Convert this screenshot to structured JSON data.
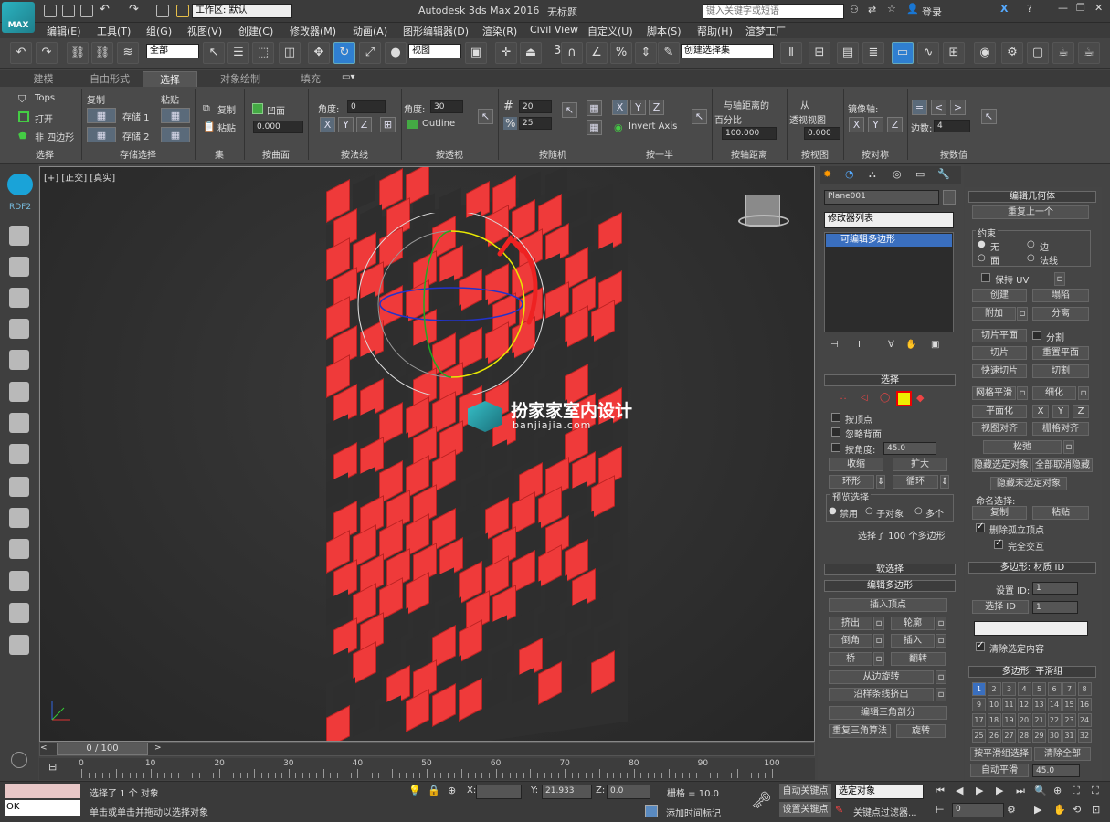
{
  "titlebar": {
    "workspace": "工作区: 默认",
    "app_title": "Autodesk 3ds Max 2016",
    "doc_title": "无标题",
    "search_placeholder": "键入关键字或短语",
    "login": "登录",
    "logo_text": "MAX"
  },
  "menubar": {
    "items": [
      "编辑(E)",
      "工具(T)",
      "组(G)",
      "视图(V)",
      "创建(C)",
      "修改器(M)",
      "动画(A)",
      "图形编辑器(D)",
      "渲染(R)",
      "Civil View",
      "自定义(U)",
      "脚本(S)",
      "帮助(H)",
      "渲梦工厂"
    ]
  },
  "toolbar": {
    "filter_select": "全部",
    "coord_select": "视图",
    "selection_set": "创建选择集",
    "snap_number": "3"
  },
  "ribbon": {
    "tabs": [
      "建模",
      "自由形式",
      "选择",
      "对象绘制",
      "填充"
    ],
    "active_tab": "选择",
    "groups": {
      "select": {
        "tops": "Tops",
        "open": "打开",
        "non_quad": "非 四边形",
        "footer": "选择"
      },
      "stored": {
        "copy": "复制",
        "paste": "粘贴",
        "store1": "存储 1",
        "store2": "存储 2",
        "footer": "存储选择"
      },
      "set": {
        "copy": "复制",
        "paste": "粘贴",
        "footer": "集"
      },
      "by_surface": {
        "concave": "凹面",
        "value": "0.000",
        "footer": "按曲面"
      },
      "by_normal": {
        "angle_label": "角度:",
        "angle": "0",
        "x": "X",
        "y": "Y",
        "z": "Z",
        "footer": "按法线"
      },
      "by_perspective": {
        "angle_label": "角度:",
        "angle": "30",
        "outline": "Outline",
        "footer": "按透视"
      },
      "by_random": {
        "count": "20",
        "percent": "25",
        "footer": "按随机"
      },
      "by_half": {
        "x": "X",
        "y": "Y",
        "z": "Z",
        "invert_axis": "Invert Axis",
        "footer": "按一半"
      },
      "by_axis_distance": {
        "label1": "与轴距离的",
        "label2": "百分比",
        "value": "100.000",
        "footer": "按轴距离"
      },
      "by_view": {
        "label1": "从",
        "label2": "透视视图",
        "value": "0.000",
        "footer": "按视图"
      },
      "by_symmetry": {
        "label": "镜像轴:",
        "x": "X",
        "y": "Y",
        "z": "Z",
        "footer": "按对称"
      },
      "by_numeric": {
        "sides_label": "边数:",
        "sides": "4",
        "footer": "按数值"
      }
    }
  },
  "leftbar": {
    "label": "RDF2"
  },
  "viewport": {
    "label": "[+] [正交] [真实]",
    "watermark": "扮家家室内设计",
    "watermark_url": "banjiajia.com",
    "tile_color": "#ef3a3a"
  },
  "command_panel": {
    "object_name": "Plane001",
    "modifier_list": "修改器列表",
    "stack_item": "可编辑多边形",
    "selection_rollout": "选择",
    "by_vertex": "按顶点",
    "ignore_backface": "忽略背面",
    "by_angle": "按角度:",
    "angle_value": "45.0",
    "shrink": "收缩",
    "grow": "扩大",
    "ring": "环形",
    "loop": "循环",
    "preview_selection": "预览选择",
    "disabled": "禁用",
    "sub_object": "子对象",
    "multi": "多个",
    "selected_count": "选择了 100 个多边形",
    "soft_selection": "软选择",
    "edit_polygons": "编辑多边形",
    "insert_vertex": "插入顶点",
    "extrude": "挤出",
    "outline": "轮廓",
    "bevel": "倒角",
    "inset": "插入",
    "bridge": "桥",
    "flip": "翻转",
    "hinge": "从边旋转",
    "extrude_spline": "沿样条线挤出",
    "edit_triangulation": "编辑三角剖分",
    "retriangulate": "重复三角算法",
    "turn": "旋转"
  },
  "edit_geometry": {
    "title": "编辑几何体",
    "repeat_last": "重复上一个",
    "constraints": "约束",
    "none": "无",
    "edge": "边",
    "face": "面",
    "normal": "法线",
    "preserve_uv": "保持 UV",
    "create": "创建",
    "collapse": "塌陷",
    "attach": "附加",
    "detach": "分离",
    "slice_plane": "切片平面",
    "split": "分割",
    "slice": "切片",
    "reset_plane": "重置平面",
    "quickslice": "快速切片",
    "cut": "切割",
    "meshsmooth": "网格平滑",
    "tessellate": "细化",
    "make_planar": "平面化",
    "x": "X",
    "y": "Y",
    "z": "Z",
    "view_align": "视图对齐",
    "grid_align": "栅格对齐",
    "relax": "松弛",
    "hide_selected": "隐藏选定对象",
    "unhide_all": "全部取消隐藏",
    "hide_unselected": "隐藏未选定对象",
    "named_selections": "命名选择:",
    "copy": "复制",
    "paste": "粘贴",
    "delete_isolated": "删除孤立顶点",
    "full_interactivity": "完全交互",
    "material_ids": "多边形: 材质 ID",
    "set_id": "设置 ID:",
    "set_id_value": "1",
    "select_id": "选择 ID",
    "select_id_value": "1",
    "clear_selection": "清除选定内容",
    "smoothing_groups": "多边形: 平滑组",
    "sg_numbers": [
      "1",
      "2",
      "3",
      "4",
      "5",
      "6",
      "7",
      "8",
      "9",
      "10",
      "11",
      "12",
      "13",
      "14",
      "15",
      "16",
      "17",
      "18",
      "19",
      "20",
      "21",
      "22",
      "23",
      "24",
      "25",
      "26",
      "27",
      "28",
      "29",
      "30",
      "31",
      "32"
    ],
    "select_by_sg": "按平滑组选择",
    "clear_all": "清除全部",
    "auto_smooth": "自动平滑",
    "auto_smooth_value": "45.0"
  },
  "timeline": {
    "frame_label": "0 / 100",
    "ticks": [
      "0",
      "10",
      "20",
      "30",
      "40",
      "50",
      "60",
      "70",
      "80",
      "90",
      "100"
    ]
  },
  "statusbar": {
    "maxscript": "OK",
    "selected": "选择了 1 个 对象",
    "prompt": "单击或单击并拖动以选择对象",
    "x_label": "X:",
    "x_value": "",
    "y_label": "Y:",
    "y_value": "21.933",
    "z_label": "Z:",
    "z_value": "0.0",
    "grid": "栅格 = 10.0",
    "add_time_tag": "添加时间标记",
    "auto_key": "自动关键点",
    "set_key": "设置关键点",
    "key_mode": "选定对象",
    "key_filters": "关键点过滤器...",
    "frame": "0"
  }
}
